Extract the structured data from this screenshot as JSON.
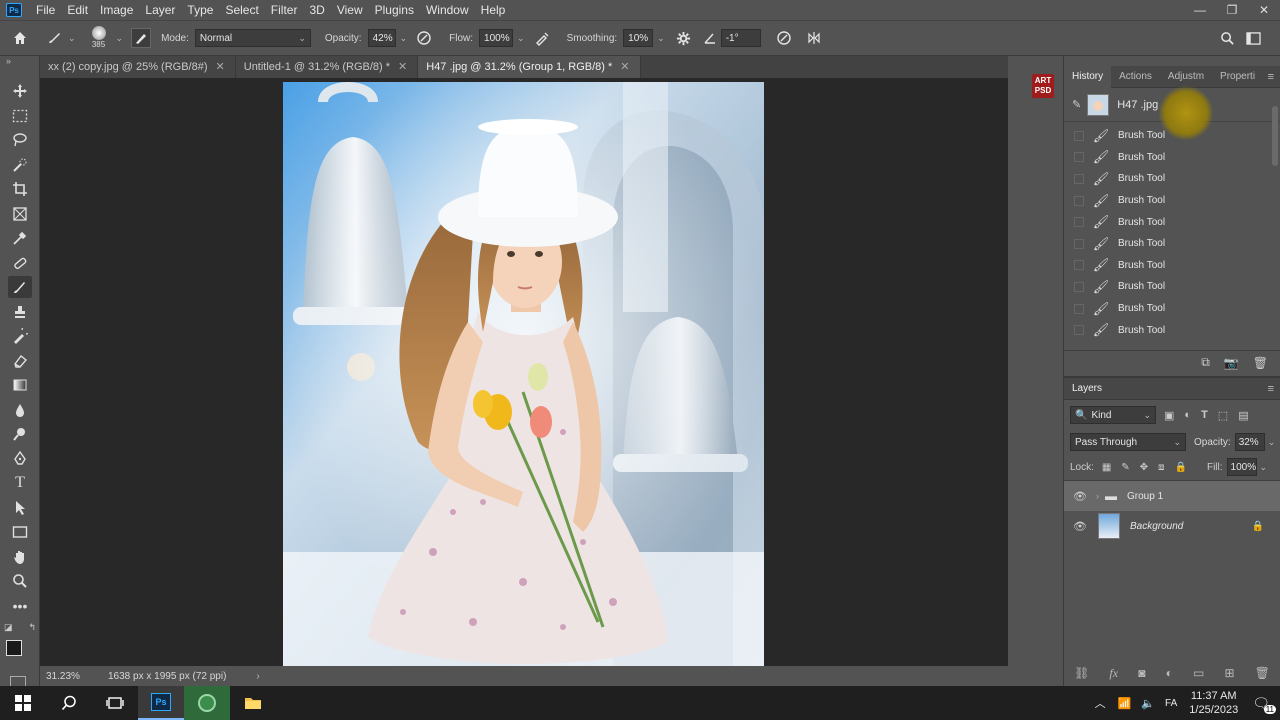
{
  "menubar": {
    "logo": "Ps",
    "items": [
      "File",
      "Edit",
      "Image",
      "Layer",
      "Type",
      "Select",
      "Filter",
      "3D",
      "View",
      "Plugins",
      "Window",
      "Help"
    ],
    "window_controls": [
      "—",
      "❐",
      "✕"
    ]
  },
  "options": {
    "brush_size": "385",
    "mode_label": "Mode:",
    "mode_value": "Normal",
    "opacity_label": "Opacity:",
    "opacity_value": "42%",
    "flow_label": "Flow:",
    "flow_value": "100%",
    "smoothing_label": "Smoothing:",
    "smoothing_value": "10%",
    "angle_value": "-1°"
  },
  "tabs": [
    {
      "label": "xx (2) copy.jpg @ 25% (RGB/8#)"
    },
    {
      "label": "Untitled-1 @ 31.2% (RGB/8) *"
    },
    {
      "label": "H47 .jpg @ 31.2% (Group 1, RGB/8) *"
    }
  ],
  "status": {
    "zoom": "31.23%",
    "doc_info": "1638 px x 1995 px (72 ppi)"
  },
  "history": {
    "tabs": [
      "History",
      "Actions",
      "Adjustm",
      "Properti"
    ],
    "snapshot_label": "H47 .jpg",
    "steps": [
      "Brush Tool",
      "Brush Tool",
      "Brush Tool",
      "Brush Tool",
      "Brush Tool",
      "Brush Tool",
      "Brush Tool",
      "Brush Tool",
      "Brush Tool",
      "Brush Tool"
    ]
  },
  "mini_panel": {
    "logo_line1": "ART",
    "logo_line2": "PSD"
  },
  "layers": {
    "title": "Layers",
    "filter_label": "Kind",
    "blend_mode": "Pass Through",
    "opacity_label": "Opacity:",
    "opacity_value": "32%",
    "lock_label": "Lock:",
    "fill_label": "Fill:",
    "fill_value": "100%",
    "items": [
      {
        "name": "Group 1"
      },
      {
        "name": "Background"
      }
    ]
  },
  "taskbar": {
    "time": "11:37 AM",
    "date": "1/25/2023",
    "lang": "FA",
    "notification_count": "11"
  }
}
